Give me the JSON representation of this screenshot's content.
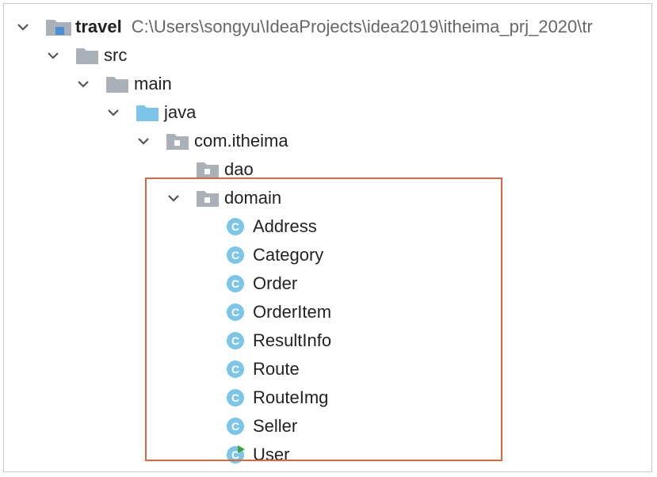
{
  "tree": {
    "root": {
      "label": "travel",
      "path": "C:\\Users\\songyu\\IdeaProjects\\idea2019\\itheima_prj_2020\\tr"
    },
    "src": {
      "label": "src"
    },
    "main": {
      "label": "main"
    },
    "java": {
      "label": "java"
    },
    "package": {
      "label": "com.itheima"
    },
    "dao": {
      "label": "dao"
    },
    "domain": {
      "label": "domain"
    },
    "classes": [
      "Address",
      "Category",
      "Order",
      "OrderItem",
      "ResultInfo",
      "Route",
      "RouteImg",
      "Seller",
      "User"
    ]
  },
  "icons": {
    "chevron": "chevron-down-icon",
    "module_folder": "module-folder-icon",
    "folder": "folder-icon",
    "source_folder": "source-folder-icon",
    "package": "package-icon",
    "class": "class-icon",
    "runnable_class": "runnable-class-icon"
  },
  "colors": {
    "highlight_border": "#d9683f",
    "class_icon": "#7cc4e8",
    "source_folder": "#7cc4e8",
    "folder_gray": "#a9b0b8",
    "run_marker": "#3aa341"
  }
}
